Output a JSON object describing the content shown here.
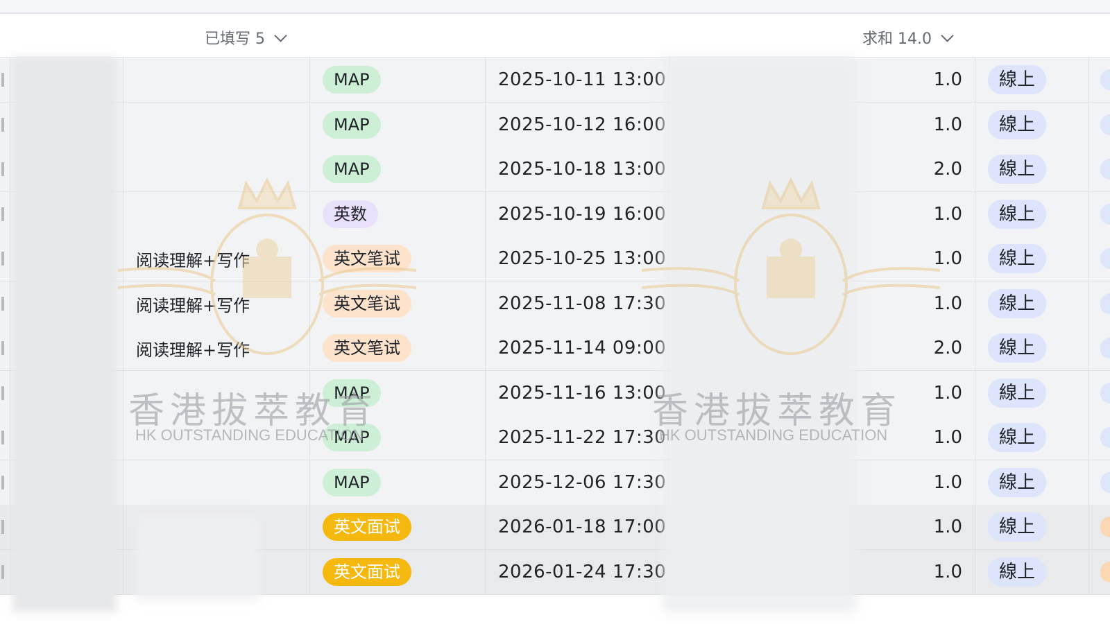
{
  "summary": {
    "filled_label": "已填写 5",
    "sum_label": "求和 14.0"
  },
  "colors": {
    "map_tag": "#cdefd6",
    "engmath_tag": "#e9e0fb",
    "written_tag": "#fde3cc",
    "interview_tag": "#f5b80f",
    "online_tag": "#dde4fb",
    "row_bg": "#f2f3f5"
  },
  "watermark": {
    "cn": "香港拔萃教育",
    "en": "HK OUTSTANDING EDUCATION"
  },
  "rows": [
    {
      "topic": "",
      "type": "MAP",
      "type_style": "map",
      "datetime": "2025-10-11 13:00",
      "hours": "1.0",
      "mode": "線上"
    },
    {
      "topic": "",
      "type": "MAP",
      "type_style": "map",
      "datetime": "2025-10-12 16:00",
      "hours": "1.0",
      "mode": "線上"
    },
    {
      "topic": "",
      "type": "MAP",
      "type_style": "map",
      "datetime": "2025-10-18 13:00",
      "hours": "2.0",
      "mode": "線上"
    },
    {
      "topic": "",
      "type": "英数",
      "type_style": "engmath",
      "datetime": "2025-10-19 16:00",
      "hours": "1.0",
      "mode": "線上"
    },
    {
      "topic": "阅读理解+写作",
      "type": "英文笔试",
      "type_style": "written",
      "datetime": "2025-10-25 13:00",
      "hours": "1.0",
      "mode": "線上"
    },
    {
      "topic": "阅读理解+写作",
      "type": "英文笔试",
      "type_style": "written",
      "datetime": "2025-11-08 17:30",
      "hours": "1.0",
      "mode": "線上"
    },
    {
      "topic": "阅读理解+写作",
      "type": "英文笔试",
      "type_style": "written",
      "datetime": "2025-11-14 09:00",
      "hours": "2.0",
      "mode": "線上"
    },
    {
      "topic": "",
      "type": "MAP",
      "type_style": "map",
      "datetime": "2025-11-16 13:00",
      "hours": "1.0",
      "mode": "線上"
    },
    {
      "topic": "",
      "type": "MAP",
      "type_style": "map",
      "datetime": "2025-11-22 17:30",
      "hours": "1.0",
      "mode": "線上"
    },
    {
      "topic": "",
      "type": "MAP",
      "type_style": "map",
      "datetime": "2025-12-06 17:30",
      "hours": "1.0",
      "mode": "線上"
    },
    {
      "topic": "",
      "type": "英文面试",
      "type_style": "interview",
      "datetime": "2026-01-18 17:00",
      "hours": "1.0",
      "mode": "線上"
    },
    {
      "topic": "",
      "type": "英文面试",
      "type_style": "interview",
      "datetime": "2026-01-24 17:30",
      "hours": "1.0",
      "mode": "線上"
    }
  ]
}
